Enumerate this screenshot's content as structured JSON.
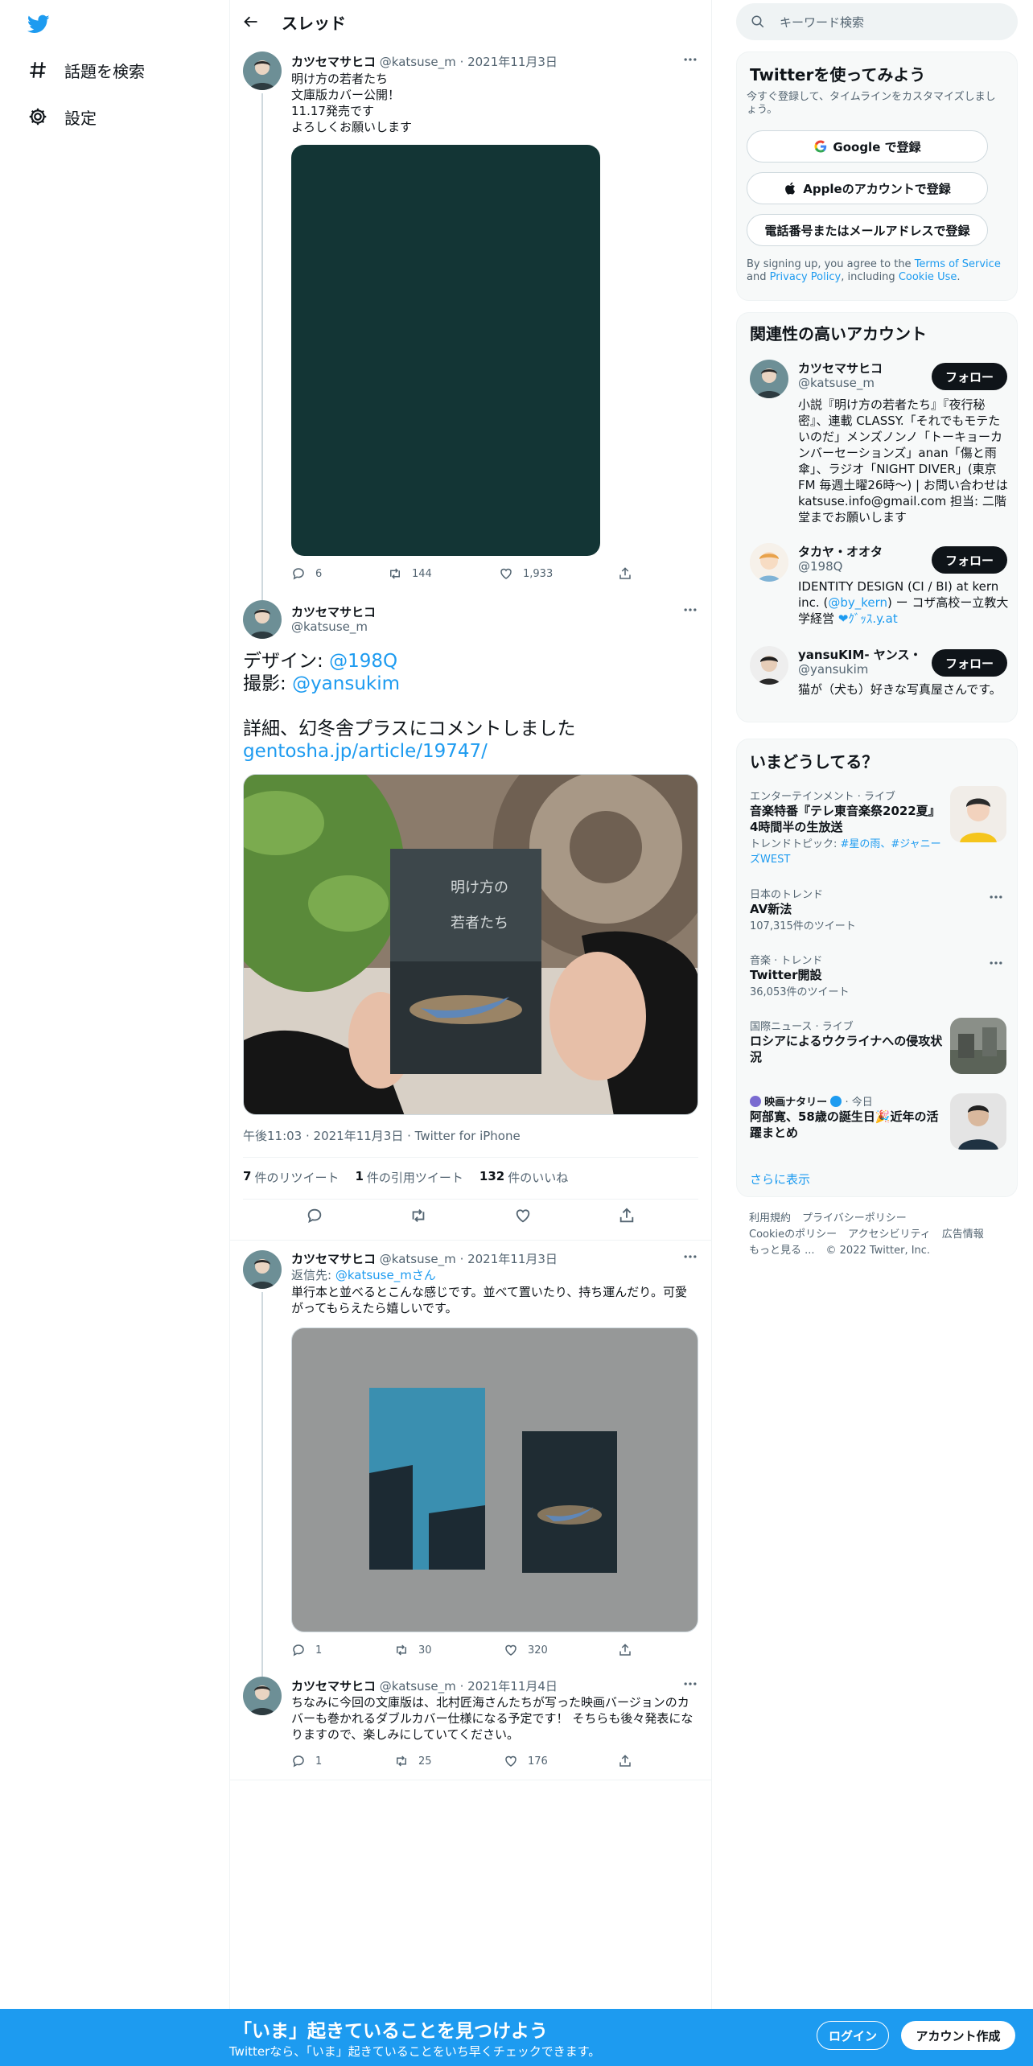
{
  "nav": {
    "explore": "話題を検索",
    "settings": "設定"
  },
  "header": {
    "title": "スレッド"
  },
  "tweet1": {
    "name": "カツセマサヒコ",
    "handle": "@katsuse_m",
    "date": "· 2021年11月3日",
    "text": "明け方の若者たち\n文庫版カバー公開！\n11.17発売です\nよろしくお願いします",
    "replies": "6",
    "retweets": "144",
    "likes": "1,933"
  },
  "focus": {
    "name": "カツセマサヒコ",
    "handle": "@katsuse_m",
    "line1_prefix": "デザイン: ",
    "line1_link": "@198Q",
    "line2_prefix": "撮影: ",
    "line2_link": "@yansukim",
    "line3": "詳細、幻冬舎プラスにコメントしました",
    "link": "gentosha.jp/article/19747/",
    "book_title_a": "明け方の",
    "book_title_b": "若者たち",
    "meta": "午後11:03 · 2021年11月3日 · Twitter for iPhone",
    "rt_count": "7",
    "rt_label": "件のリツイート",
    "quote_count": "1",
    "quote_label": "件の引用ツイート",
    "like_count": "132",
    "like_label": "件のいいね"
  },
  "tweet3": {
    "name": "カツセマサヒコ",
    "handle": "@katsuse_m",
    "date": "· 2021年11月3日",
    "reply_prefix": "返信先: ",
    "reply_to": "@katsuse_mさん",
    "text": "単行本と並べるとこんな感じです。並べて置いたり、持ち運んだり。可愛\nがってもらえたら嬉しいです。",
    "replies": "1",
    "retweets": "30",
    "likes": "320"
  },
  "tweet4": {
    "name": "カツセマサヒコ",
    "handle": "@katsuse_m",
    "date": "· 2021年11月4日",
    "text": "ちなみに今回の文庫版は、北村匠海さんたちが写った映画バージョンのカ\nバーも巻かれるダブルカバー仕様になる予定です！ そちらも後々発表にな\nりますので、楽しみにしていてください。",
    "replies": "1",
    "retweets": "25",
    "likes": "176"
  },
  "search": {
    "placeholder": "キーワード検索"
  },
  "signup": {
    "title": "Twitterを使ってみよう",
    "subtitle": "今すぐ登録して、タイムラインをカスタマイズしましょう。",
    "google": "Google で登録",
    "apple": "Appleのアカウントで登録",
    "phone": "電話番号またはメールアドレスで登録",
    "legal_1": "By signing up, you agree to the ",
    "terms": "Terms of Service",
    "legal_2": " and ",
    "privacy": "Privacy Policy",
    "legal_3": ", including ",
    "cookie": "Cookie Use",
    "legal_4": "."
  },
  "related": {
    "title": "関連性の高いアカウント",
    "follow": "フォロー",
    "accounts": [
      {
        "name": "カツセマサヒコ",
        "handle": "@katsuse_m",
        "bio": "小説『明け方の若者たち』『夜行秘密』、連載 CLASSY.「それでもモテたいのだ」メンズノンノ「トーキョーカンバーセーションズ」anan「傷と雨傘」、ラジオ「NIGHT DIVER」(東京FM 毎週土曜26時〜) | お問い合わせは katsuse.info@gmail.com 担当: 二階堂までお願いします"
      },
      {
        "name": "タカヤ・オオタ",
        "handle": "@198Q",
        "bio_1": "IDENTITY DESIGN (CI / BI) at kern inc. (",
        "bio_link": "@by_kern",
        "bio_2": ") ー コザ高校ー立教大学経営 ",
        "bio_3": "❤︎ｸﾞｯｽ.y.at"
      },
      {
        "name": "yansuKIM- ヤンス・...",
        "handle": "@yansukim",
        "bio": "猫が（犬も）好きな写真屋さんです。"
      }
    ]
  },
  "trends": {
    "title": "いまどうしてる？",
    "items": [
      {
        "context": "エンターテインメント · ライブ",
        "title": "音楽特番『テレ東音楽祭2022夏』4時間半の生放送",
        "sub_prefix": "トレンドトピック: ",
        "sub_link": "#星の雨、#ジャニーズWEST"
      },
      {
        "context": "日本のトレンド",
        "title": "AV新法",
        "sub": "107,315件のツイート"
      },
      {
        "context": "音楽 · トレンド",
        "title": "Twitter開設",
        "sub": "36,053件のツイート"
      },
      {
        "context": "国際ニュース · ライブ",
        "title": "ロシアによるウクライナへの侵攻状況"
      },
      {
        "context_name": "映画ナタリー",
        "context_suffix": " · 今日",
        "title": "阿部寛、58歳の誕生日🎉近年の活躍まとめ"
      }
    ],
    "more": "さらに表示"
  },
  "footer": {
    "terms": "利用規約",
    "privacy": "プライバシーポリシー",
    "cookie": "Cookieのポリシー",
    "accessibility": "アクセシビリティ",
    "ads": "広告情報",
    "more": "もっと見る ...",
    "copyright": "© 2022 Twitter, Inc."
  },
  "bottom": {
    "heading": "「いま」起きていることを見つけよう",
    "sub": "Twitterなら、「いま」起きていることをいち早くチェックできます。",
    "login": "ログイン",
    "signup": "アカウント作成"
  },
  "colors": {
    "accent": "#1d9bf0",
    "cover_green": "#133535",
    "text": "#0f1419",
    "secondary": "#536471"
  }
}
